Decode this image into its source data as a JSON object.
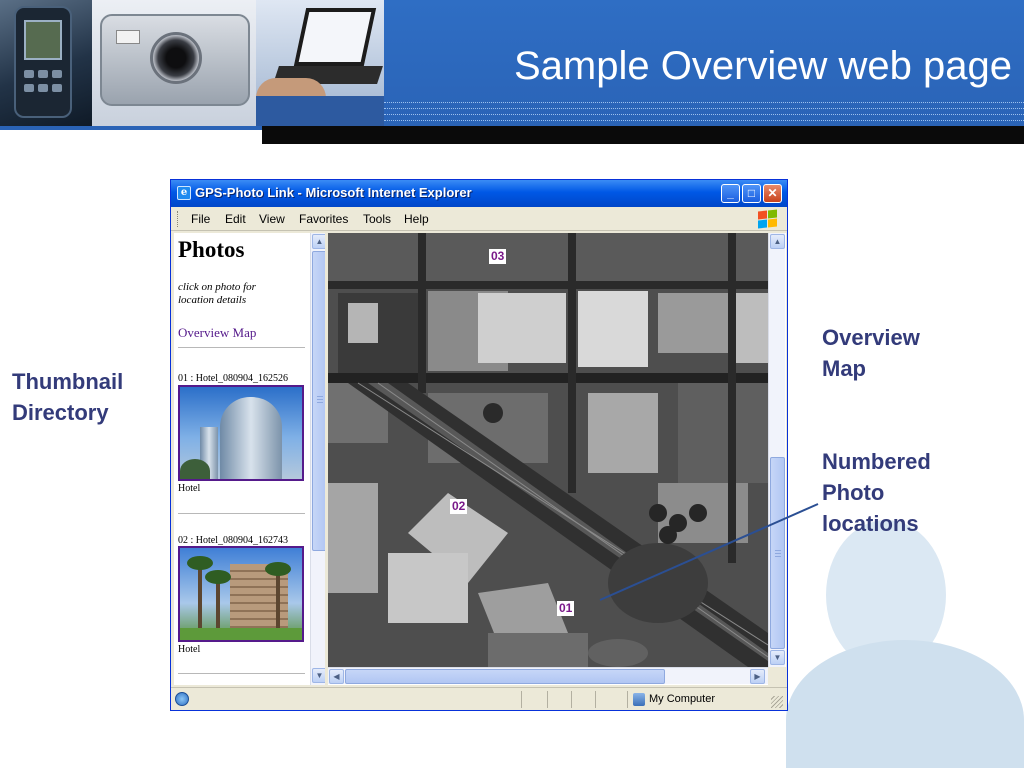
{
  "slide": {
    "title": "Sample Overview web page",
    "annotations": {
      "thumbnail_directory": [
        "Thumbnail",
        "Directory"
      ],
      "overview_map": [
        "Overview",
        "Map"
      ],
      "numbered_locations": [
        "Numbered",
        "Photo",
        "locations"
      ]
    }
  },
  "browser": {
    "window_title": "GPS-Photo Link - Microsoft Internet Explorer",
    "menu": [
      "File",
      "Edit",
      "View",
      "Favorites",
      "Tools",
      "Help"
    ],
    "status_zone": "My Computer"
  },
  "left_frame": {
    "heading": "Photos",
    "hint": "click on photo for location details",
    "overview_link": "Overview Map",
    "photos": [
      {
        "caption": "01 : Hotel_080904_162526",
        "label": "Hotel"
      },
      {
        "caption": "02 : Hotel_080904_162743",
        "label": "Hotel"
      }
    ]
  },
  "map": {
    "markers": [
      "03",
      "02",
      "01"
    ]
  },
  "colors": {
    "slide_blue": "#2f6ec4",
    "annotation_text": "#333b7a",
    "visited_link": "#551a8b",
    "marker_text": "#7a1a8a",
    "xp_titlebar": "#0058e6"
  },
  "icons": [
    "ie-page-icon",
    "minimize-icon",
    "maximize-icon",
    "close-icon",
    "windows-logo-icon",
    "scroll-up-icon",
    "scroll-down-icon",
    "scroll-left-icon",
    "scroll-right-icon",
    "ie-status-icon",
    "my-computer-icon"
  ]
}
